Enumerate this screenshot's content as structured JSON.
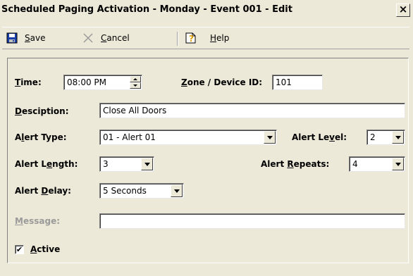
{
  "window": {
    "title": "Scheduled Paging Activation - Monday - Event 001 - Edit",
    "close_glyph": "×"
  },
  "toolbar": {
    "save_label": "Save",
    "cancel_label": "Cancel",
    "help_label": "Help"
  },
  "form": {
    "time": {
      "label": "Time:",
      "value": "08:00 PM"
    },
    "zone": {
      "label": "Zone / Device ID:",
      "value": "101"
    },
    "description": {
      "label": "Desciption:",
      "value": "Close All Doors"
    },
    "alert_type": {
      "label": "Alert Type:",
      "value": "01 - Alert 01"
    },
    "alert_level": {
      "label": "Alert Level:",
      "value": "2"
    },
    "alert_length": {
      "label": "Alert Length:",
      "value": "3"
    },
    "alert_repeats": {
      "label": "Alert Repeats:",
      "value": "4"
    },
    "alert_delay": {
      "label": "Alert Delay:",
      "value": "5 Seconds"
    },
    "message": {
      "label": "Message:",
      "value": ""
    },
    "active": {
      "label": "Active",
      "checked": true,
      "check_glyph": "✔"
    }
  }
}
